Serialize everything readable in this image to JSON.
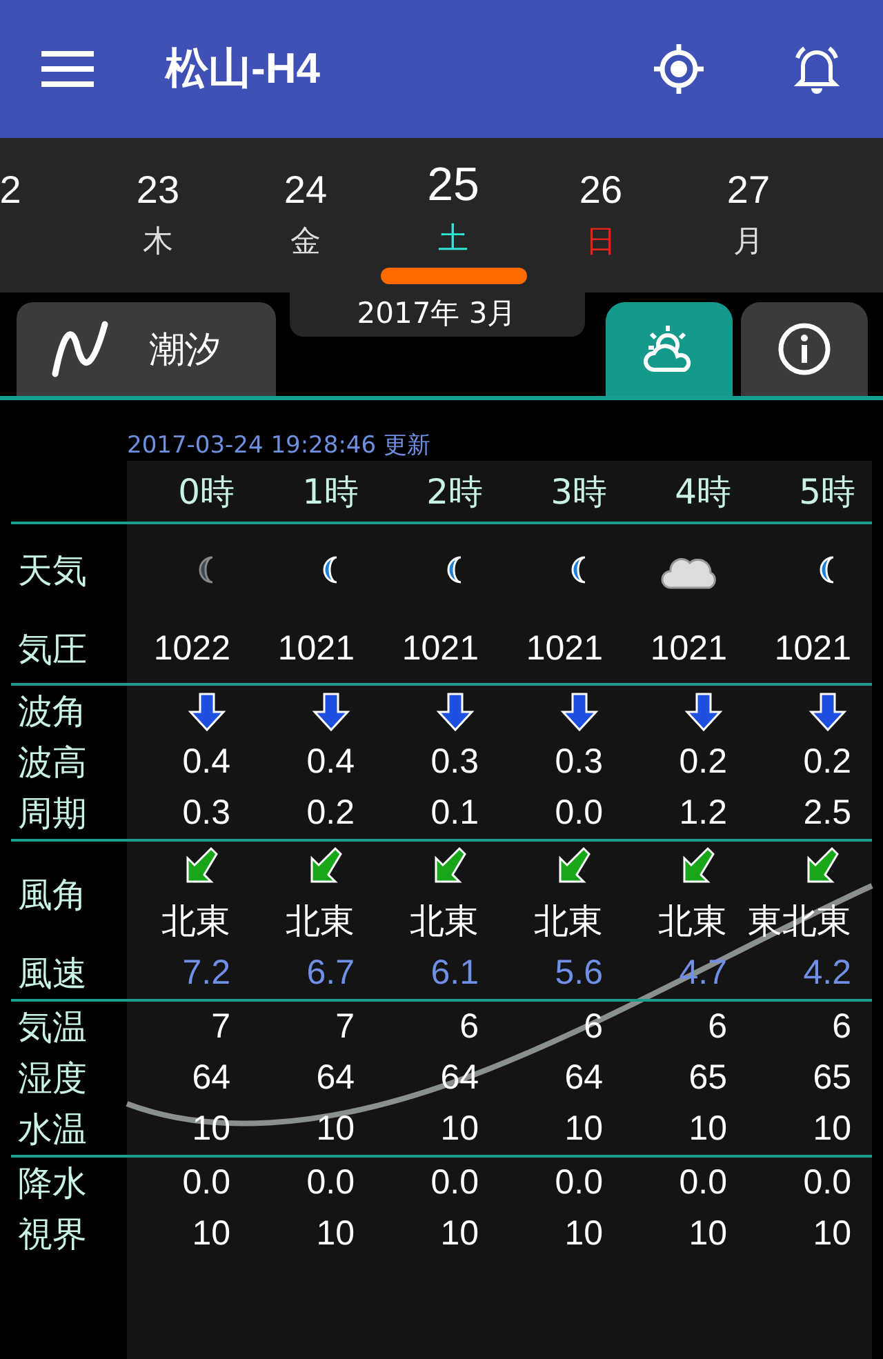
{
  "app_bar": {
    "title": "松山-H4"
  },
  "dates": [
    {
      "day": "2",
      "selected": false
    },
    {
      "day": "23",
      "weekday": "木",
      "selected": false
    },
    {
      "day": "24",
      "weekday": "金",
      "selected": false
    },
    {
      "day": "25",
      "weekday": "土",
      "selected": true,
      "color": "#2ee6d6"
    },
    {
      "day": "26",
      "weekday": "日",
      "selected": false,
      "color": "#e0261c"
    },
    {
      "day": "27",
      "weekday": "月",
      "selected": false
    }
  ],
  "month_label": "2017年 3月",
  "tabs": [
    {
      "kind": "tide",
      "label": "潮汐",
      "selected": false
    },
    {
      "kind": "weather",
      "selected": true
    },
    {
      "kind": "info",
      "selected": false
    }
  ],
  "updated": "2017-03-24 19:28:46 更新",
  "hours": [
    "0時",
    "1時",
    "2時",
    "3時",
    "4時",
    "5時"
  ],
  "rows": [
    {
      "kind": "weather",
      "label": "天気",
      "icons": [
        {
          "kind": "moon-dim"
        },
        {
          "kind": "moon"
        },
        {
          "kind": "moon"
        },
        {
          "kind": "moon"
        },
        {
          "kind": "cloud"
        },
        {
          "kind": "moon"
        }
      ]
    },
    {
      "kind": "text",
      "label": "気圧",
      "values": [
        "1022",
        "1021",
        "1021",
        "1021",
        "1021",
        "1021"
      ],
      "divider": true
    },
    {
      "kind": "wave-arrow",
      "label": "波角"
    },
    {
      "kind": "text",
      "label": "波高",
      "values": [
        "0.4",
        "0.4",
        "0.3",
        "0.3",
        "0.2",
        "0.2"
      ]
    },
    {
      "kind": "text",
      "label": "周期",
      "values": [
        "0.3",
        "0.2",
        "0.1",
        "0.0",
        "1.2",
        "2.5"
      ],
      "divider": true
    },
    {
      "kind": "wind",
      "label": "風角",
      "values": [
        "北東",
        "北東",
        "北東",
        "北東",
        "北東",
        "東北東"
      ]
    },
    {
      "kind": "speed",
      "label": "風速",
      "values": [
        "7.2",
        "6.7",
        "6.1",
        "5.6",
        "4.7",
        "4.2"
      ],
      "divider": true
    },
    {
      "kind": "text",
      "label": "気温",
      "values": [
        "7",
        "7",
        "6",
        "6",
        "6",
        "6"
      ]
    },
    {
      "kind": "text",
      "label": "湿度",
      "values": [
        "64",
        "64",
        "64",
        "64",
        "65",
        "65"
      ]
    },
    {
      "kind": "text",
      "label": "水温",
      "values": [
        "10",
        "10",
        "10",
        "10",
        "10",
        "10"
      ],
      "divider": true
    },
    {
      "kind": "text",
      "label": "降水",
      "values": [
        "0.0",
        "0.0",
        "0.0",
        "0.0",
        "0.0",
        "0.0"
      ]
    },
    {
      "kind": "text",
      "label": "視界",
      "values": [
        "10",
        "10",
        "10",
        "10",
        "10",
        "10"
      ]
    }
  ]
}
